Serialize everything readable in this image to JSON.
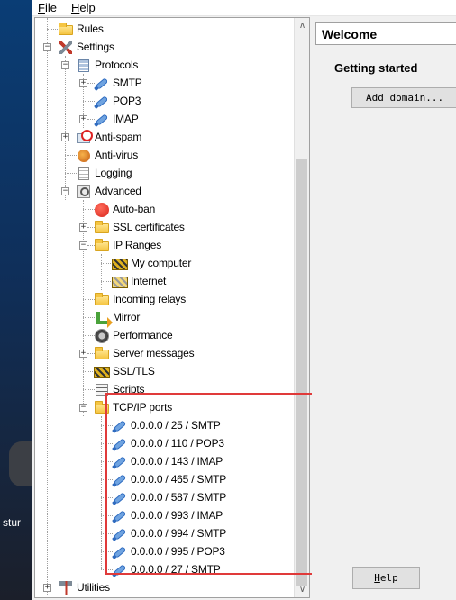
{
  "menu": {
    "file": {
      "accel": "F",
      "rest": "ile"
    },
    "help": {
      "accel": "H",
      "rest": "elp"
    }
  },
  "desktop": {
    "label": "stur"
  },
  "tree": {
    "rules": "Rules",
    "settings": "Settings",
    "protocols": "Protocols",
    "smtp": "SMTP",
    "pop3": "POP3",
    "imap": "IMAP",
    "anti_spam": "Anti-spam",
    "anti_virus": "Anti-virus",
    "logging": "Logging",
    "advanced": "Advanced",
    "auto_ban": "Auto-ban",
    "ssl_certificates": "SSL certificates",
    "ip_ranges": "IP Ranges",
    "my_computer": "My computer",
    "internet": "Internet",
    "incoming_relays": "Incoming relays",
    "mirror": "Mirror",
    "performance": "Performance",
    "server_messages": "Server messages",
    "ssl_tls": "SSL/TLS",
    "scripts": "Scripts",
    "tcp_ip_ports": "TCP/IP ports",
    "ports": [
      "0.0.0.0 / 25 / SMTP",
      "0.0.0.0 / 110 / POP3",
      "0.0.0.0 / 143 / IMAP",
      "0.0.0.0 / 465 / SMTP",
      "0.0.0.0 / 587 / SMTP",
      "0.0.0.0 / 993 / IMAP",
      "0.0.0.0 / 994 / SMTP",
      "0.0.0.0 / 995 / POP3",
      "0.0.0.0 / 27 / SMTP"
    ],
    "utilities": "Utilities"
  },
  "welcome": {
    "title": "Welcome",
    "getting_started": "Getting started",
    "add_domain": "Add domain...",
    "help_accel": "H",
    "help_rest": "elp"
  },
  "colors": {
    "highlight_border": "#e03a3a",
    "desktop_bg": "#0b3b6e",
    "window_bg": "#f0f0f0"
  }
}
